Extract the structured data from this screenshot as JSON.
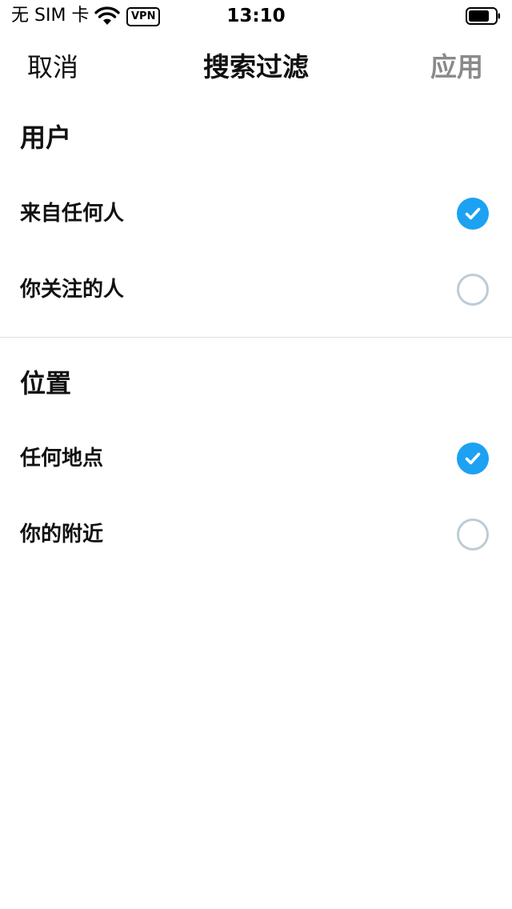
{
  "status_bar": {
    "carrier": "无 SIM 卡",
    "vpn": "VPN",
    "time": "13:10"
  },
  "nav": {
    "cancel_label": "取消",
    "title": "搜索过滤",
    "apply_label": "应用"
  },
  "sections": [
    {
      "heading": "用户",
      "options": [
        {
          "label": "来自任何人",
          "selected": true
        },
        {
          "label": "你关注的人",
          "selected": false
        }
      ]
    },
    {
      "heading": "位置",
      "options": [
        {
          "label": "任何地点",
          "selected": true
        },
        {
          "label": "你的附近",
          "selected": false
        }
      ]
    }
  ],
  "colors": {
    "accent": "#1DA1F2",
    "radio_empty": "#BCCCD6",
    "apply_disabled": "#8A8A8A",
    "divider": "#DCDFE2"
  },
  "icons": {
    "wifi": "wifi-icon",
    "battery": "battery-icon",
    "selected": "checkmark-circle-icon",
    "unselected": "empty-circle-icon"
  }
}
